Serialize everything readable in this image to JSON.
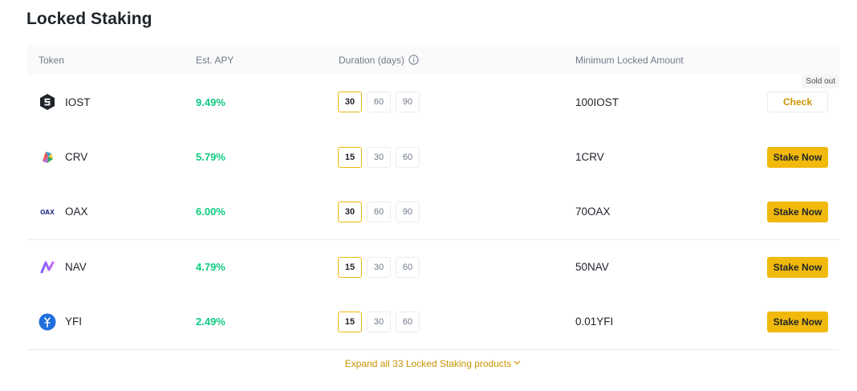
{
  "title": "Locked Staking",
  "columns": {
    "token": "Token",
    "apy": "Est. APY",
    "duration": "Duration (days)",
    "min_amount": "Minimum Locked Amount"
  },
  "rows": [
    {
      "token": "IOST",
      "icon": "iost-icon",
      "apy": "9.49%",
      "durations": [
        "30",
        "60",
        "90"
      ],
      "active": 0,
      "min": "100IOST",
      "action": "Check",
      "badge": "Sold out"
    },
    {
      "token": "CRV",
      "icon": "crv-icon",
      "apy": "5.79%",
      "durations": [
        "15",
        "30",
        "60"
      ],
      "active": 0,
      "min": "1CRV",
      "action": "Stake Now"
    },
    {
      "token": "OAX",
      "icon": "oax-icon",
      "apy": "6.00%",
      "durations": [
        "30",
        "60",
        "90"
      ],
      "active": 0,
      "min": "70OAX",
      "action": "Stake Now"
    },
    {
      "token": "NAV",
      "icon": "nav-icon",
      "apy": "4.79%",
      "durations": [
        "15",
        "30",
        "60"
      ],
      "active": 0,
      "min": "50NAV",
      "action": "Stake Now"
    },
    {
      "token": "YFI",
      "icon": "yfi-icon",
      "apy": "2.49%",
      "durations": [
        "15",
        "30",
        "60"
      ],
      "active": 0,
      "min": "0.01YFI",
      "action": "Stake Now"
    }
  ],
  "expand_label": "Expand all 33 Locked Staking products",
  "colors": {
    "accent": "#f0b90b",
    "positive": "#0ecb81",
    "link": "#c99400"
  }
}
